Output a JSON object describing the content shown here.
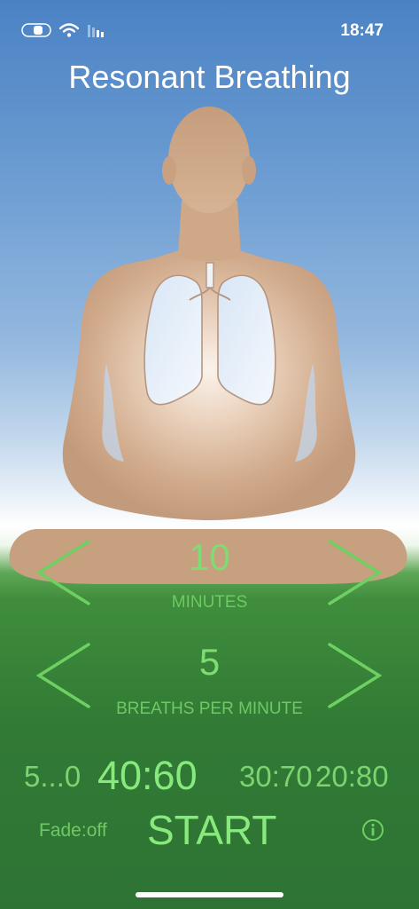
{
  "status": {
    "time": "18:47",
    "icons": [
      "toggle-icon",
      "wifi-icon",
      "signal-icon"
    ]
  },
  "app": {
    "title": "Resonant Breathing"
  },
  "minutes": {
    "value": "10",
    "label": "MINUTES"
  },
  "breaths": {
    "value": "5",
    "label": "BREATHS PER MINUTE"
  },
  "ratios": {
    "items": [
      "5...0",
      "40:60",
      "30:70",
      "20:80"
    ],
    "selected": "40:60"
  },
  "controls": {
    "fade": "Fade:off",
    "start": "START",
    "info_icon": "info-icon"
  },
  "colors": {
    "accent": "#7ddc72",
    "body_fill": "#c9a27f",
    "sky": "#4a82c4",
    "grass": "#317a35"
  }
}
